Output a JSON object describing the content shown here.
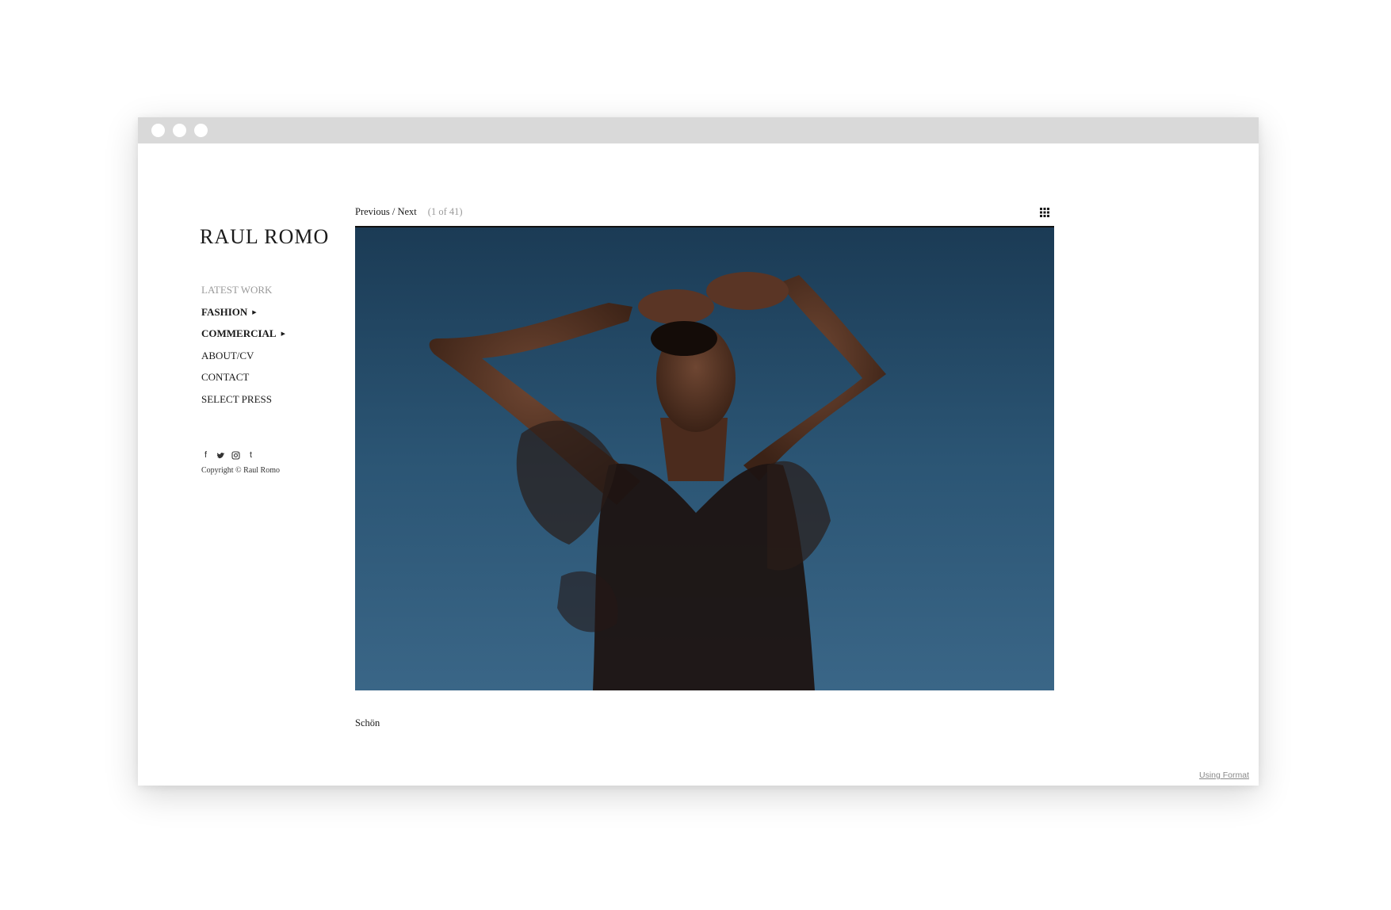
{
  "site": {
    "logo": "RAUL ROMO"
  },
  "nav": {
    "items": [
      {
        "label": "LATEST WORK"
      },
      {
        "label": "FASHION"
      },
      {
        "label": "COMMERCIAL"
      },
      {
        "label": "ABOUT/CV"
      },
      {
        "label": "CONTACT"
      },
      {
        "label": "SELECT PRESS"
      }
    ],
    "caret": "▶"
  },
  "social": {
    "icons": [
      "facebook-icon",
      "twitter-icon",
      "instagram-icon",
      "tumblr-icon"
    ],
    "facebook_glyph": "f",
    "tumblr_glyph": "t"
  },
  "footer": {
    "copyright": "Copyright © Raul Romo",
    "powered_by": "Using Format"
  },
  "gallery": {
    "previous_label": "Previous",
    "separator": " / ",
    "next_label": "Next",
    "counter": "(1 of 41)",
    "caption": "Schön"
  },
  "colors": {
    "sky_top": "#1b3b55",
    "sky_bottom": "#3a6687",
    "muted_text": "#9a9a9a",
    "chrome": "#d9d9d9"
  }
}
